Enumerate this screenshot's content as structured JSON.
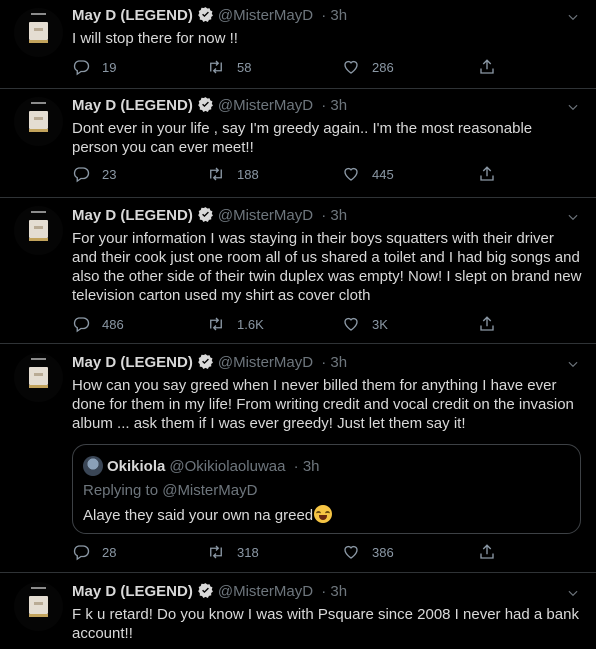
{
  "author": {
    "name": "May D (LEGEND)",
    "handle": "@MisterMayD"
  },
  "tweets": [
    {
      "time": "3h",
      "text": "I will stop there for now !!",
      "replies": "19",
      "retweets": "58",
      "likes": "286"
    },
    {
      "time": "3h",
      "text": "Dont ever in your life , say I'm greedy again.. I'm the most reasonable person you can ever meet!!",
      "replies": "23",
      "retweets": "188",
      "likes": "445"
    },
    {
      "time": "3h",
      "text": "For your information I was staying in their boys squatters with their driver and their cook just one room all of us shared a toilet and I had big songs and also the other side of their twin duplex was empty! Now! I slept on brand new television carton used my shirt as cover cloth",
      "replies": "486",
      "retweets": "1.6K",
      "likes": "3K"
    },
    {
      "time": "3h",
      "text": "How can you say greed when I never billed them for anything I have ever done for them in my life! From writing credit and vocal credit on the invasion album ... ask them if I was ever greedy! Just let them say it!",
      "replies": "28",
      "retweets": "318",
      "likes": "386",
      "quote": {
        "name": "Okikiola",
        "handle": "@Okikiolaoluwaa",
        "time": "3h",
        "replying": "Replying to @MisterMayD",
        "text": "Alaye they said your own na greed"
      }
    },
    {
      "time": "3h",
      "text": "F  k u retard! Do you know I was with Psquare since 2008 I never had a bank account!!"
    }
  ],
  "colors": {
    "background": "#000000",
    "text": "#d9d9d9",
    "muted": "#6e767d",
    "verified": "#d9d9d9",
    "divider": "#2f3336"
  }
}
